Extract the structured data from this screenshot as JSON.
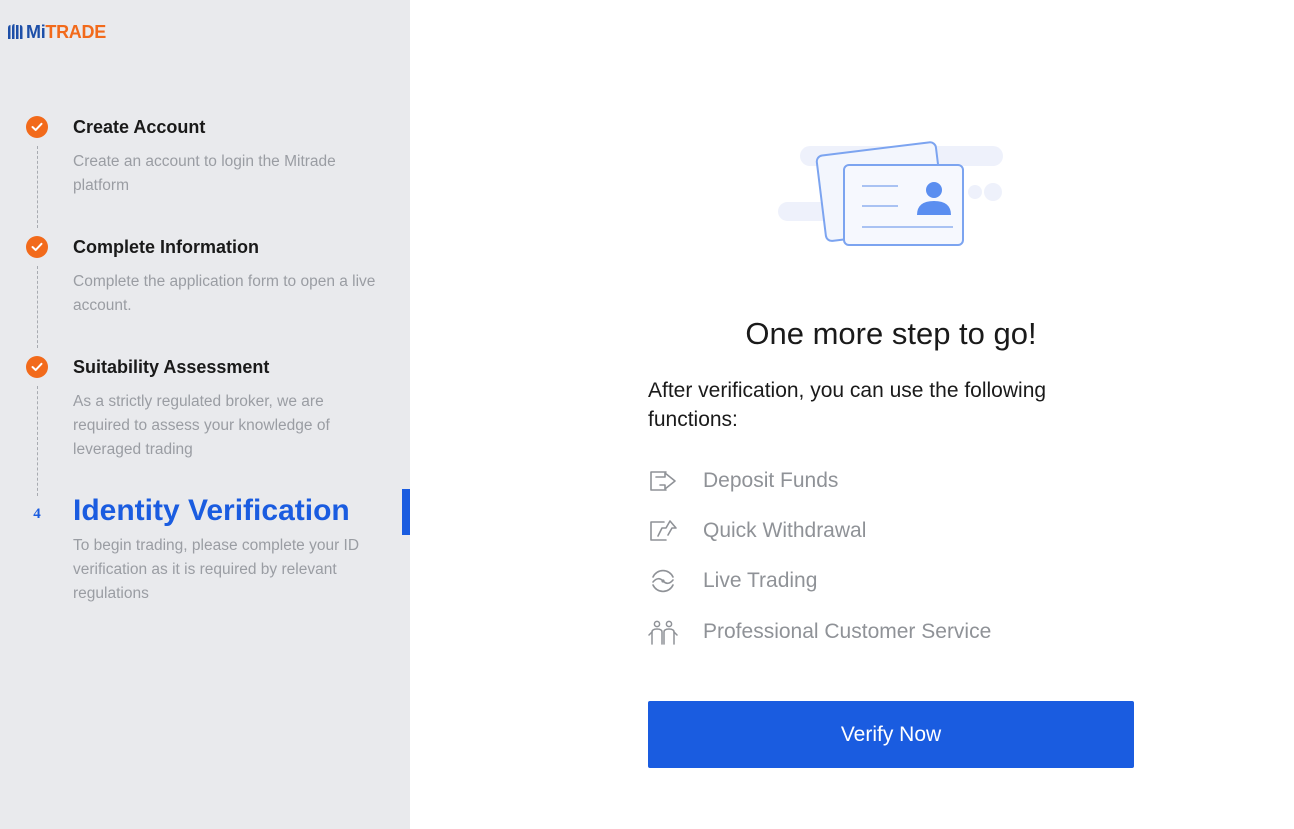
{
  "brand": {
    "mi": "Mi",
    "trade": "TRADE"
  },
  "steps": [
    {
      "title": "Create Account",
      "desc": "Create an account to login the Mitrade platform",
      "icon": "check-icon"
    },
    {
      "title": "Complete Information",
      "desc": "Complete the application form to open a live account.",
      "icon": "check-icon"
    },
    {
      "title": "Suitability Assessment",
      "desc": "As a strictly regulated broker, we are required to assess your knowledge of leveraged trading",
      "icon": "check-icon"
    },
    {
      "number": "4",
      "title": "Identity Verification",
      "desc": "To begin trading, please complete your ID verification as it is required by relevant regulations"
    }
  ],
  "main": {
    "headline": "One more step to go!",
    "intro": "After verification, you can use the following functions:",
    "features": [
      {
        "label": "Deposit Funds",
        "icon": "deposit-icon"
      },
      {
        "label": "Quick Withdrawal",
        "icon": "withdrawal-icon"
      },
      {
        "label": "Live Trading",
        "icon": "live-trading-icon"
      },
      {
        "label": "Professional Customer Service",
        "icon": "customer-service-icon"
      }
    ],
    "verify_label": "Verify Now"
  },
  "colors": {
    "accent_blue": "#1a5ce0",
    "brand_orange": "#f26a1b",
    "sidebar_bg": "#e9eaed",
    "muted_text": "#9a9da3"
  }
}
